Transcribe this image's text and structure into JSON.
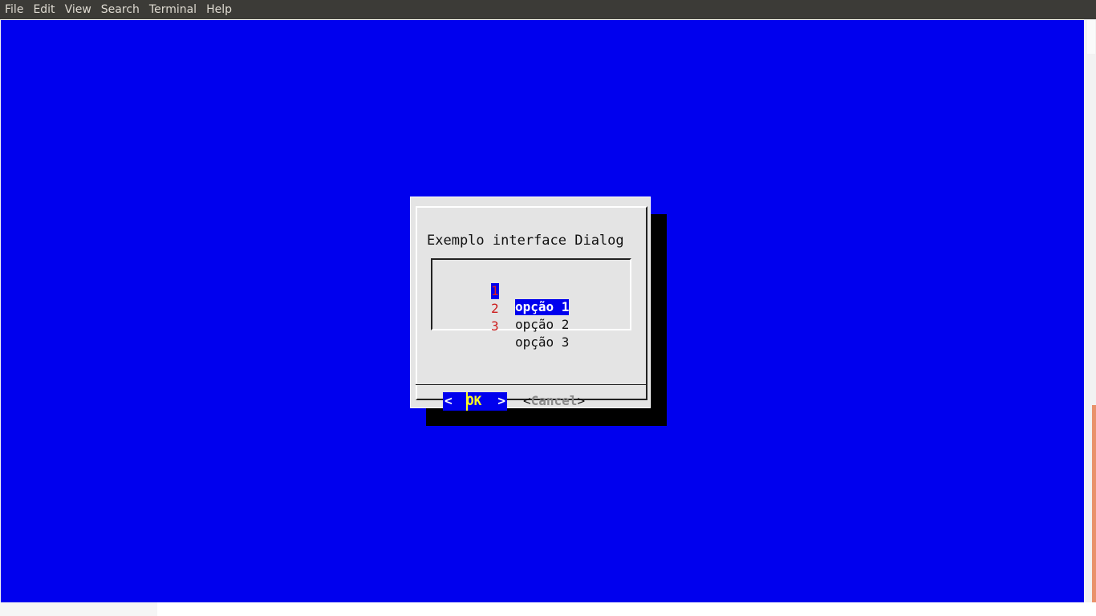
{
  "menubar": {
    "items": [
      "File",
      "Edit",
      "View",
      "Search",
      "Terminal",
      "Help"
    ]
  },
  "dialog": {
    "title": "Exemplo interface Dialog",
    "items": [
      {
        "tag": "1",
        "label": "opção 1",
        "selected": true
      },
      {
        "tag": "2",
        "label": "opção 2",
        "selected": false
      },
      {
        "tag": "3",
        "label": "opção 3",
        "selected": false
      }
    ],
    "ok_button": {
      "left": "<",
      "label": "OK",
      "right": ">"
    },
    "cancel_button": {
      "open": "<",
      "label": "Cancel",
      "close": ">"
    }
  },
  "colors": {
    "terminal_bg": "#0000ee",
    "dialog_bg": "#e4e4e4",
    "tag_red": "#cc1d1d",
    "highlight_yellow": "#ffff22",
    "menubar_bg": "#3c3b37"
  }
}
